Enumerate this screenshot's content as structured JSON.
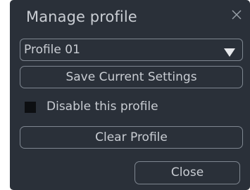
{
  "dialog": {
    "title": "Manage profile",
    "close_icon": "close-icon"
  },
  "profile_select": {
    "value": "Profile 01",
    "arrow_icon": "triangle-down-icon"
  },
  "buttons": {
    "save_label": "Save Current Settings",
    "clear_label": "Clear Profile",
    "close_label": "Close"
  },
  "disable_option": {
    "label": "Disable this profile",
    "checked": false
  },
  "colors": {
    "background": "#2a3039",
    "text": "#c9cdd3",
    "border": "#7f8791",
    "checkbox_fill": "#0d0f12"
  }
}
